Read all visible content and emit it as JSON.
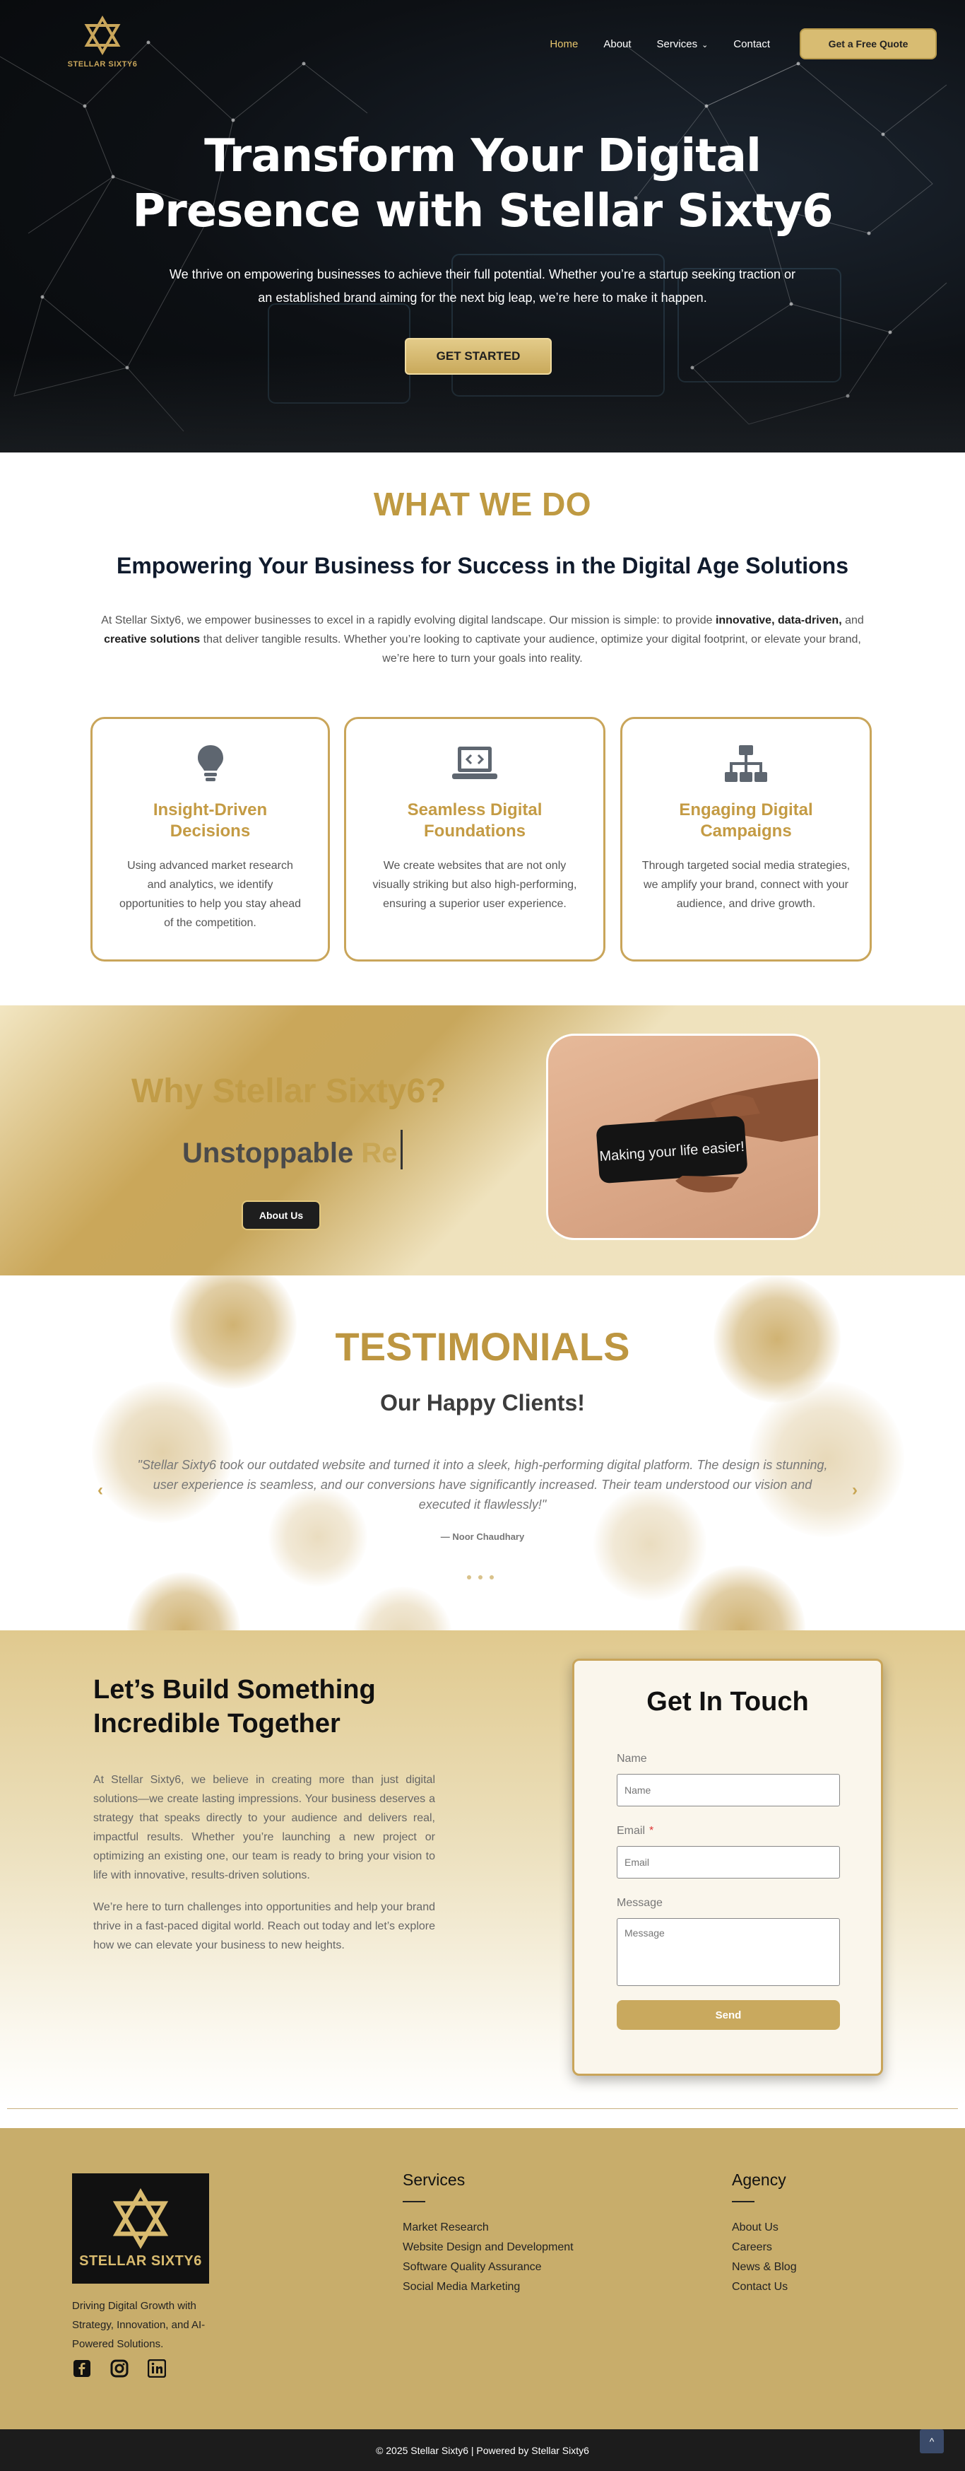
{
  "brand": {
    "logo_text": "STELLAR SIXTY6"
  },
  "nav": {
    "items": [
      {
        "label": "Home"
      },
      {
        "label": "About"
      },
      {
        "label": "Services"
      },
      {
        "label": "Contact"
      }
    ],
    "quote_button": "Get a Free Quote"
  },
  "hero": {
    "title_line1": "Transform Your Digital",
    "title_line2": "Presence with Stellar Sixty6",
    "subtitle_line1": "We thrive on empowering businesses to achieve their full potential. Whether you’re a startup seeking traction or",
    "subtitle_line2": "an established brand aiming for the next big leap, we’re here to make it happen.",
    "cta": "GET STARTED"
  },
  "what_we_do": {
    "title": "WHAT WE DO",
    "subtitle": "Empowering Your Business for Success in the Digital Age Solutions",
    "text_a": "At Stellar Sixty6, we empower businesses to excel in a rapidly evolving digital landscape. Our mission is simple: to provide ",
    "text_bold1": "innovative, data-driven,",
    "text_b": " and ",
    "text_bold2": "creative solutions",
    "text_c": " that deliver tangible results. Whether you’re looking to captivate your audience, optimize your digital footprint, or elevate your brand, we’re here to turn your goals into reality.",
    "cards": [
      {
        "title": "Insight-Driven Decisions",
        "text": "Using advanced market research and analytics, we identify opportunities to help you stay ahead of the competition.",
        "icon": "lightbulb-icon"
      },
      {
        "title": "Seamless Digital Foundations",
        "text": "We create websites that are not only visually striking but also high-performing, ensuring a superior user experience.",
        "icon": "laptop-code-icon"
      },
      {
        "title": "Engaging Digital Campaigns",
        "text": "Through targeted social media strategies, we amplify your brand, connect with your audience, and drive growth.",
        "icon": "sitemap-icon"
      }
    ]
  },
  "why": {
    "title": "Why Stellar Sixty6?",
    "typed_word": "Unstoppable",
    "typed_partial": "Re",
    "button": "About Us",
    "card_text": "Making your life easier!"
  },
  "testimonials": {
    "title": "TESTIMONIALS",
    "subtitle": "Our Happy Clients!",
    "quote": "\"Stellar Sixty6 took our outdated website and turned it into a sleek, high-performing digital platform. The design is stunning, user experience is seamless, and our conversions have significantly increased. Their team understood our vision and executed it flawlessly!\"",
    "author": "— Noor Chaudhary",
    "prev": "‹",
    "next": "›"
  },
  "contact": {
    "heading_line1": "Let’s Build Something",
    "heading_line2": "Incredible Together",
    "para1": "At Stellar Sixty6, we believe in creating more than just digital solutions—we create lasting impressions. Your business deserves a strategy that speaks directly to your audience and delivers real, impactful results. Whether you’re launching a new project or optimizing an existing one, our team is ready to bring your vision to life with innovative, results-driven solutions.",
    "para2": "We’re here to turn challenges into opportunities and help your brand thrive in a fast-paced digital world. Reach out today and let’s explore how we can elevate your business to new heights.",
    "form": {
      "title": "Get In Touch",
      "name_label": "Name",
      "name_placeholder": "Name",
      "email_label": "Email",
      "required_mark": "*",
      "email_placeholder": "Email",
      "message_label": "Message",
      "message_placeholder": "Message",
      "send": "Send"
    }
  },
  "footer": {
    "logo_text": "STELLAR SIXTY6",
    "tagline": "Driving Digital Growth with Strategy, Innovation, and AI-Powered Solutions.",
    "social_icons": [
      "facebook-icon",
      "instagram-icon",
      "linkedin-icon"
    ],
    "services_title": "Services",
    "services": [
      "Market Research",
      "Website Design and Development",
      "Software Quality Assurance",
      "Social Media Marketing"
    ],
    "agency_title": "Agency",
    "agency": [
      "About Us",
      "Careers",
      "News & Blog",
      "Contact Us"
    ],
    "copyright": "© 2025 Stellar Sixty6 | Powered by Stellar Sixty6",
    "to_top": "^"
  },
  "colors": {
    "gold": "#c9a55a",
    "dark": "#0d1014",
    "navy": "#101b2d"
  }
}
